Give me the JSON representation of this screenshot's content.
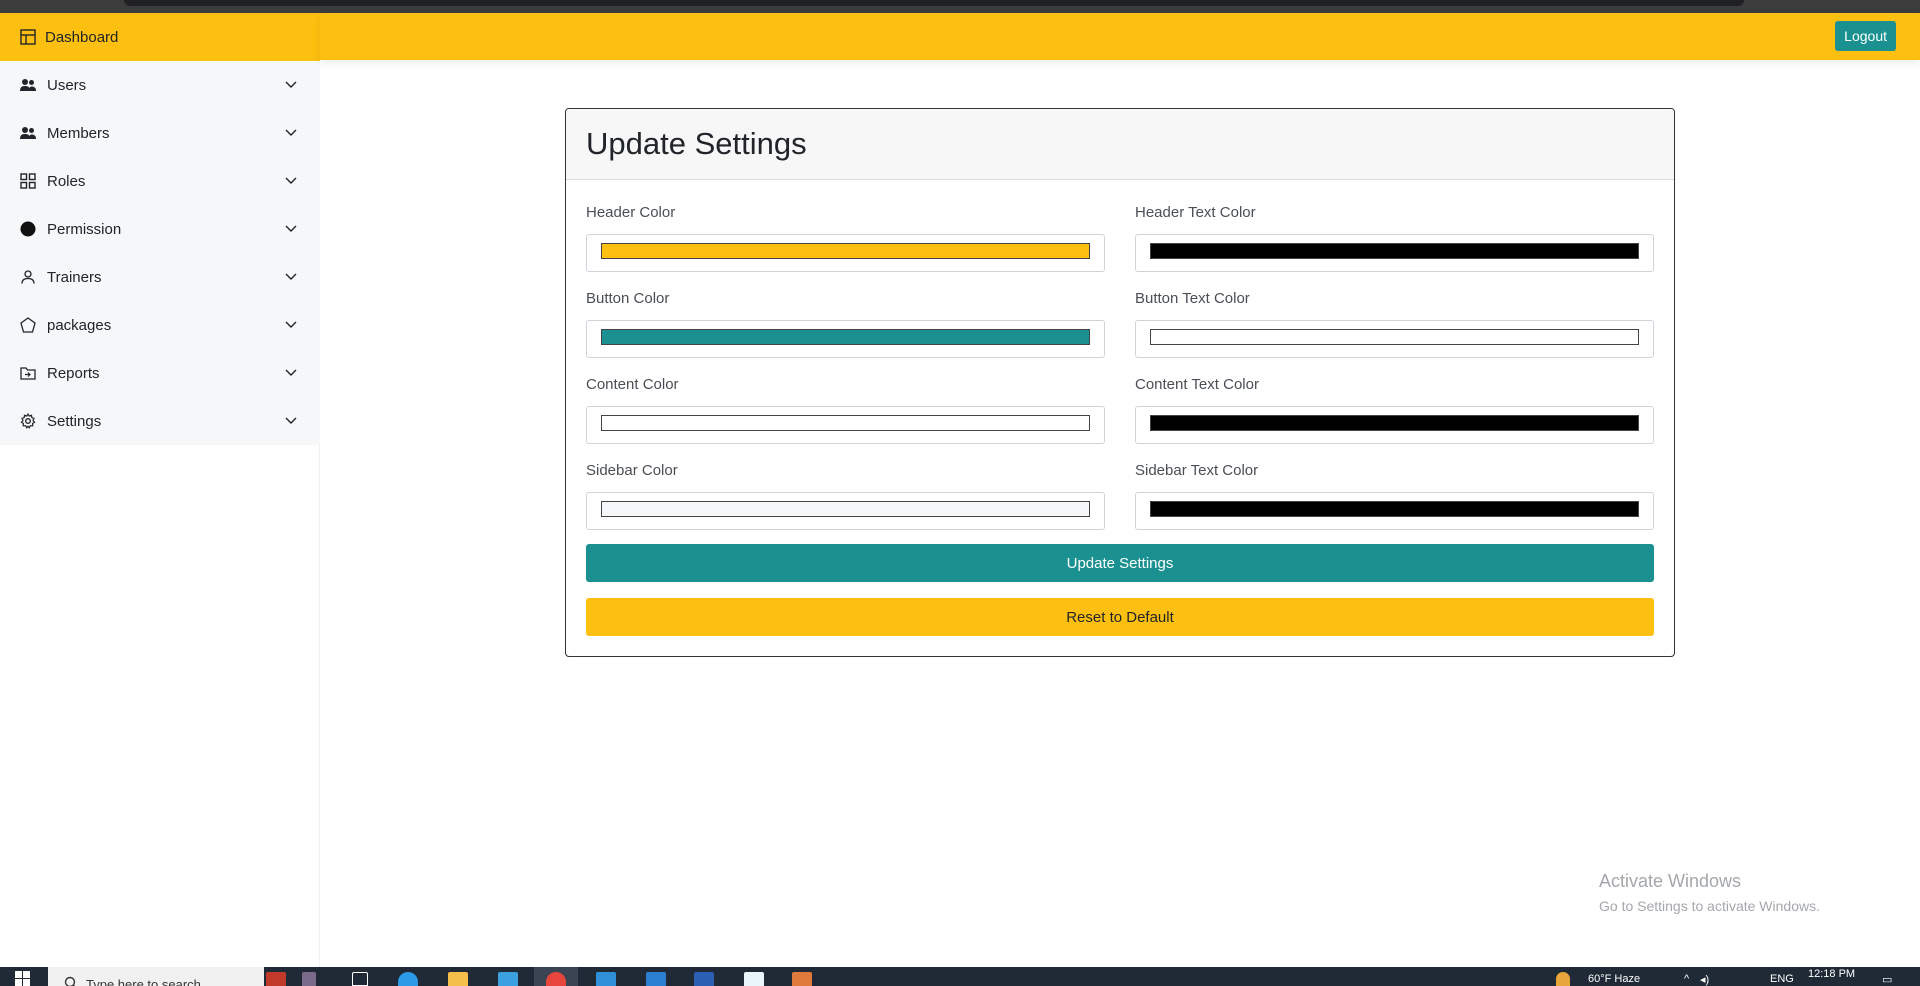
{
  "sidebar": {
    "brand_label": "Dashboard",
    "items": [
      {
        "label": "Users",
        "icon": "users-icon"
      },
      {
        "label": "Members",
        "icon": "users-icon"
      },
      {
        "label": "Roles",
        "icon": "grid-icon"
      },
      {
        "label": "Permission",
        "icon": "circle-icon"
      },
      {
        "label": "Trainers",
        "icon": "person-icon"
      },
      {
        "label": "packages",
        "icon": "pentagon-icon"
      },
      {
        "label": "Reports",
        "icon": "folder-icon"
      },
      {
        "label": "Settings",
        "icon": "gear-icon"
      }
    ]
  },
  "header": {
    "logout_label": "Logout"
  },
  "settings_card": {
    "title": "Update Settings",
    "fields": [
      {
        "label": "Header Color",
        "value": "#fdc010"
      },
      {
        "label": "Header Text Color",
        "value": "#000000"
      },
      {
        "label": "Button Color",
        "value": "#1a9090"
      },
      {
        "label": "Button Text Color",
        "value": "#ffffff"
      },
      {
        "label": "Content Color",
        "value": "#ffffff"
      },
      {
        "label": "Content Text Color",
        "value": "#000000"
      },
      {
        "label": "Sidebar Color",
        "value": "#f5f7f9"
      },
      {
        "label": "Sidebar Text Color",
        "value": "#000000"
      }
    ],
    "update_button_label": "Update Settings",
    "reset_button_label": "Reset to Default"
  },
  "watermark": {
    "title": "Activate Windows",
    "subtitle": "Go to Settings to activate Windows."
  },
  "taskbar": {
    "search_placeholder": "Type here to search",
    "weather": "60°F  Haze",
    "language": "ENG",
    "time": "12:18 PM"
  },
  "colors": {
    "accent_yellow": "#fdc010",
    "accent_teal": "#1a9090",
    "sidebar_bg": "#f5f7f9"
  }
}
